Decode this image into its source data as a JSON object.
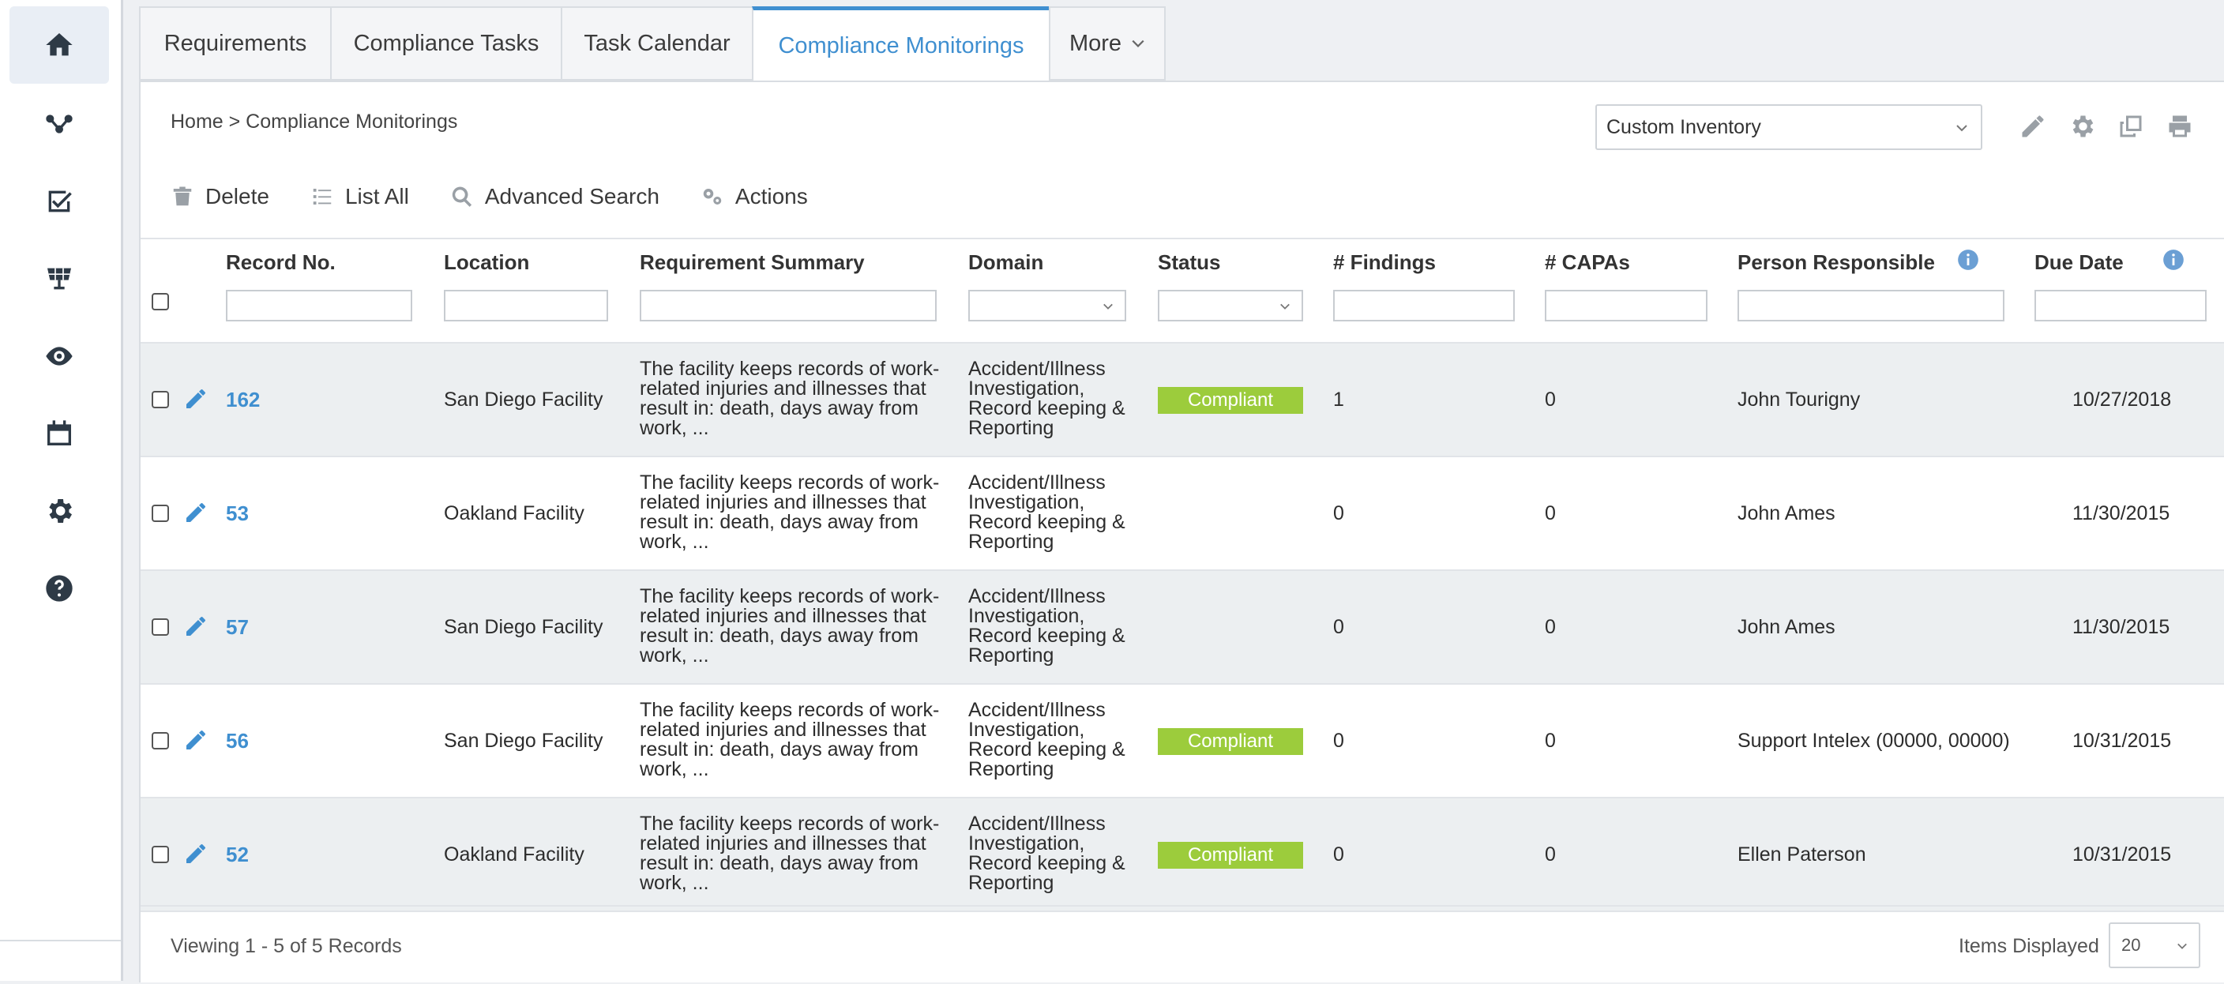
{
  "sidebar": {
    "items": [
      {
        "icon": "home-icon",
        "active": true
      },
      {
        "icon": "workflow-icon"
      },
      {
        "icon": "checkbox-icon"
      },
      {
        "icon": "solar-panel-icon"
      },
      {
        "icon": "eye-icon"
      },
      {
        "icon": "calendar-icon"
      },
      {
        "icon": "gear-icon"
      },
      {
        "icon": "help-icon"
      }
    ]
  },
  "tabs": [
    {
      "label": "Requirements"
    },
    {
      "label": "Compliance Tasks"
    },
    {
      "label": "Task Calendar"
    },
    {
      "label": "Compliance Monitorings",
      "active": true
    },
    {
      "label": "More"
    }
  ],
  "breadcrumb": "Home > Compliance Monitorings",
  "inventory_select": {
    "value": "Custom Inventory"
  },
  "top_icons": [
    "pencil-icon",
    "gear-icon",
    "copy-icon",
    "print-icon"
  ],
  "toolbar": {
    "delete_label": "Delete",
    "list_all_label": "List All",
    "advanced_search_label": "Advanced Search",
    "actions_label": "Actions"
  },
  "table": {
    "columns": [
      "Record No.",
      "Location",
      "Requirement Summary",
      "Domain",
      "Status",
      "# Findings",
      "# CAPAs",
      "Person Responsible",
      "Due Date"
    ],
    "rows": [
      {
        "record": "162",
        "location": "San Diego Facility",
        "summary": "The facility keeps records of work-related injuries and illnesses that result in: death, days away from work, ...",
        "domain": "Accident/Illness Investigation, Record keeping & Reporting",
        "status": "Compliant",
        "findings": "1",
        "capas": "0",
        "person": "John Tourigny",
        "due": "10/27/2018"
      },
      {
        "record": "53",
        "location": "Oakland Facility",
        "summary": "The facility keeps records of work-related injuries and illnesses that result in: death, days away from work, ...",
        "domain": "Accident/Illness Investigation, Record keeping & Reporting",
        "status": "",
        "findings": "0",
        "capas": "0",
        "person": "John Ames",
        "due": "11/30/2015"
      },
      {
        "record": "57",
        "location": "San Diego Facility",
        "summary": "The facility keeps records of work-related injuries and illnesses that result in: death, days away from work, ...",
        "domain": "Accident/Illness Investigation, Record keeping & Reporting",
        "status": "",
        "findings": "0",
        "capas": "0",
        "person": "John Ames",
        "due": "11/30/2015"
      },
      {
        "record": "56",
        "location": "San Diego Facility",
        "summary": "The facility keeps records of work-related injuries and illnesses that result in: death, days away from work, ...",
        "domain": "Accident/Illness Investigation, Record keeping & Reporting",
        "status": "Compliant",
        "findings": "0",
        "capas": "0",
        "person": "Support Intelex (00000, 00000)",
        "due": "10/31/2015"
      },
      {
        "record": "52",
        "location": "Oakland Facility",
        "summary": "The facility keeps records of work-related injuries and illnesses that result in: death, days away from work, ...",
        "domain": "Accident/Illness Investigation, Record keeping & Reporting",
        "status": "Compliant",
        "findings": "0",
        "capas": "0",
        "person": "Ellen Paterson",
        "due": "10/31/2015"
      }
    ]
  },
  "footer": {
    "viewing": "Viewing 1 - 5 of 5 Records",
    "items_label": "Items Displayed",
    "items_value": "20"
  },
  "colors": {
    "accent": "#3f8fd0",
    "compliant": "#9ccc3c",
    "row_alt": "#eceff1"
  }
}
